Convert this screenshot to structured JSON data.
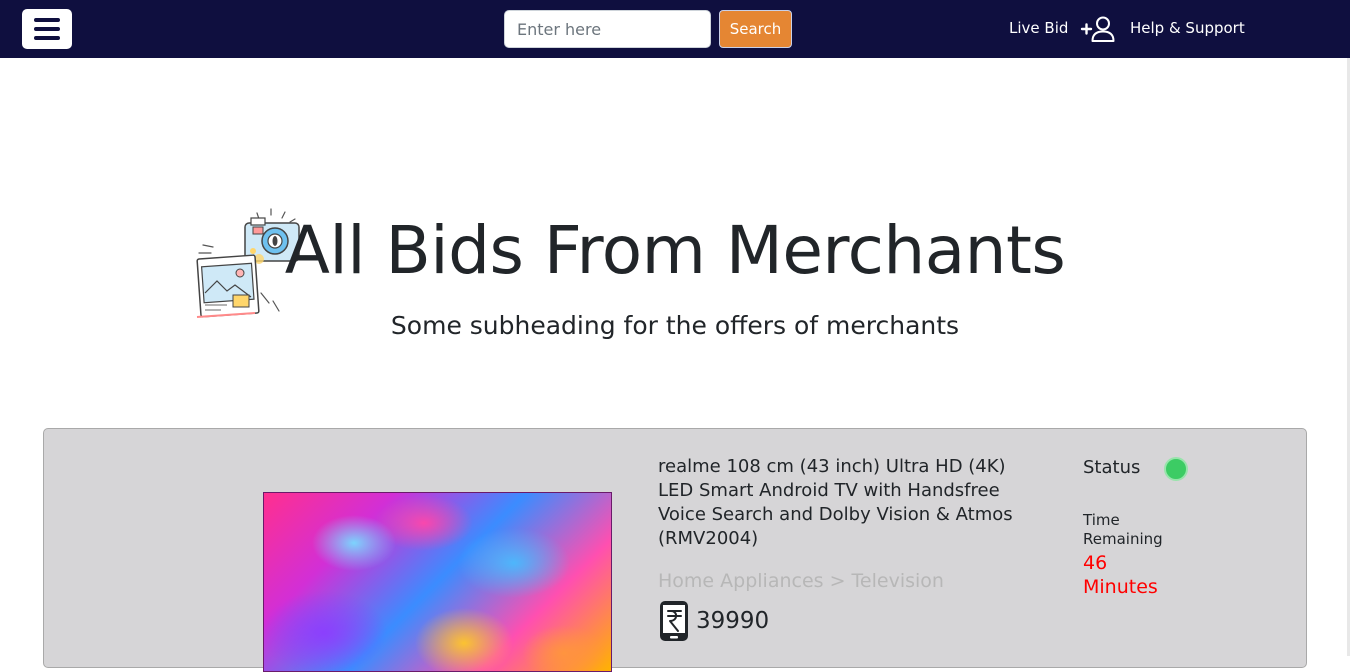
{
  "header": {
    "search_placeholder": "Enter here",
    "search_button": "Search",
    "nav_live_bid": "Live Bid",
    "nav_help": "Help & Support"
  },
  "hero": {
    "title": "All Bids From Merchants",
    "subtitle": "Some subheading for the offers of merchants"
  },
  "bid_card": {
    "product_title": "realme 108 cm (43 inch) Ultra HD (4K) LED Smart Android TV with Handsfree Voice Search and Dolby Vision & Atmos (RMV2004)",
    "category_path": "Home Appliances > Television",
    "price": "39990",
    "status_label": "Status",
    "status_color": "#3ccc64",
    "time_label": "Time Remaining",
    "time_value": "46 Minutes"
  },
  "colors": {
    "header_bg": "#0f0f3f",
    "search_button_bg": "#e58633",
    "card_bg": "#d6d5d7",
    "time_value": "#ff0000"
  },
  "icons": [
    "menu-icon",
    "user-plus-icon",
    "camera-photo-illustration",
    "mobile-rupee-icon",
    "status-dot"
  ]
}
